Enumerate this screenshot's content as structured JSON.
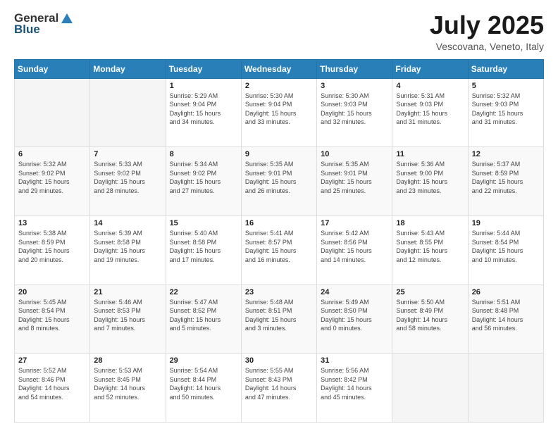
{
  "header": {
    "logo": {
      "general": "General",
      "blue": "Blue"
    },
    "title": "July 2025",
    "location": "Vescovana, Veneto, Italy"
  },
  "calendar": {
    "days_of_week": [
      "Sunday",
      "Monday",
      "Tuesday",
      "Wednesday",
      "Thursday",
      "Friday",
      "Saturday"
    ],
    "weeks": [
      [
        {
          "day": "",
          "info": ""
        },
        {
          "day": "",
          "info": ""
        },
        {
          "day": "1",
          "info": "Sunrise: 5:29 AM\nSunset: 9:04 PM\nDaylight: 15 hours\nand 34 minutes."
        },
        {
          "day": "2",
          "info": "Sunrise: 5:30 AM\nSunset: 9:04 PM\nDaylight: 15 hours\nand 33 minutes."
        },
        {
          "day": "3",
          "info": "Sunrise: 5:30 AM\nSunset: 9:03 PM\nDaylight: 15 hours\nand 32 minutes."
        },
        {
          "day": "4",
          "info": "Sunrise: 5:31 AM\nSunset: 9:03 PM\nDaylight: 15 hours\nand 31 minutes."
        },
        {
          "day": "5",
          "info": "Sunrise: 5:32 AM\nSunset: 9:03 PM\nDaylight: 15 hours\nand 31 minutes."
        }
      ],
      [
        {
          "day": "6",
          "info": "Sunrise: 5:32 AM\nSunset: 9:02 PM\nDaylight: 15 hours\nand 29 minutes."
        },
        {
          "day": "7",
          "info": "Sunrise: 5:33 AM\nSunset: 9:02 PM\nDaylight: 15 hours\nand 28 minutes."
        },
        {
          "day": "8",
          "info": "Sunrise: 5:34 AM\nSunset: 9:02 PM\nDaylight: 15 hours\nand 27 minutes."
        },
        {
          "day": "9",
          "info": "Sunrise: 5:35 AM\nSunset: 9:01 PM\nDaylight: 15 hours\nand 26 minutes."
        },
        {
          "day": "10",
          "info": "Sunrise: 5:35 AM\nSunset: 9:01 PM\nDaylight: 15 hours\nand 25 minutes."
        },
        {
          "day": "11",
          "info": "Sunrise: 5:36 AM\nSunset: 9:00 PM\nDaylight: 15 hours\nand 23 minutes."
        },
        {
          "day": "12",
          "info": "Sunrise: 5:37 AM\nSunset: 8:59 PM\nDaylight: 15 hours\nand 22 minutes."
        }
      ],
      [
        {
          "day": "13",
          "info": "Sunrise: 5:38 AM\nSunset: 8:59 PM\nDaylight: 15 hours\nand 20 minutes."
        },
        {
          "day": "14",
          "info": "Sunrise: 5:39 AM\nSunset: 8:58 PM\nDaylight: 15 hours\nand 19 minutes."
        },
        {
          "day": "15",
          "info": "Sunrise: 5:40 AM\nSunset: 8:58 PM\nDaylight: 15 hours\nand 17 minutes."
        },
        {
          "day": "16",
          "info": "Sunrise: 5:41 AM\nSunset: 8:57 PM\nDaylight: 15 hours\nand 16 minutes."
        },
        {
          "day": "17",
          "info": "Sunrise: 5:42 AM\nSunset: 8:56 PM\nDaylight: 15 hours\nand 14 minutes."
        },
        {
          "day": "18",
          "info": "Sunrise: 5:43 AM\nSunset: 8:55 PM\nDaylight: 15 hours\nand 12 minutes."
        },
        {
          "day": "19",
          "info": "Sunrise: 5:44 AM\nSunset: 8:54 PM\nDaylight: 15 hours\nand 10 minutes."
        }
      ],
      [
        {
          "day": "20",
          "info": "Sunrise: 5:45 AM\nSunset: 8:54 PM\nDaylight: 15 hours\nand 8 minutes."
        },
        {
          "day": "21",
          "info": "Sunrise: 5:46 AM\nSunset: 8:53 PM\nDaylight: 15 hours\nand 7 minutes."
        },
        {
          "day": "22",
          "info": "Sunrise: 5:47 AM\nSunset: 8:52 PM\nDaylight: 15 hours\nand 5 minutes."
        },
        {
          "day": "23",
          "info": "Sunrise: 5:48 AM\nSunset: 8:51 PM\nDaylight: 15 hours\nand 3 minutes."
        },
        {
          "day": "24",
          "info": "Sunrise: 5:49 AM\nSunset: 8:50 PM\nDaylight: 15 hours\nand 0 minutes."
        },
        {
          "day": "25",
          "info": "Sunrise: 5:50 AM\nSunset: 8:49 PM\nDaylight: 14 hours\nand 58 minutes."
        },
        {
          "day": "26",
          "info": "Sunrise: 5:51 AM\nSunset: 8:48 PM\nDaylight: 14 hours\nand 56 minutes."
        }
      ],
      [
        {
          "day": "27",
          "info": "Sunrise: 5:52 AM\nSunset: 8:46 PM\nDaylight: 14 hours\nand 54 minutes."
        },
        {
          "day": "28",
          "info": "Sunrise: 5:53 AM\nSunset: 8:45 PM\nDaylight: 14 hours\nand 52 minutes."
        },
        {
          "day": "29",
          "info": "Sunrise: 5:54 AM\nSunset: 8:44 PM\nDaylight: 14 hours\nand 50 minutes."
        },
        {
          "day": "30",
          "info": "Sunrise: 5:55 AM\nSunset: 8:43 PM\nDaylight: 14 hours\nand 47 minutes."
        },
        {
          "day": "31",
          "info": "Sunrise: 5:56 AM\nSunset: 8:42 PM\nDaylight: 14 hours\nand 45 minutes."
        },
        {
          "day": "",
          "info": ""
        },
        {
          "day": "",
          "info": ""
        }
      ]
    ]
  }
}
